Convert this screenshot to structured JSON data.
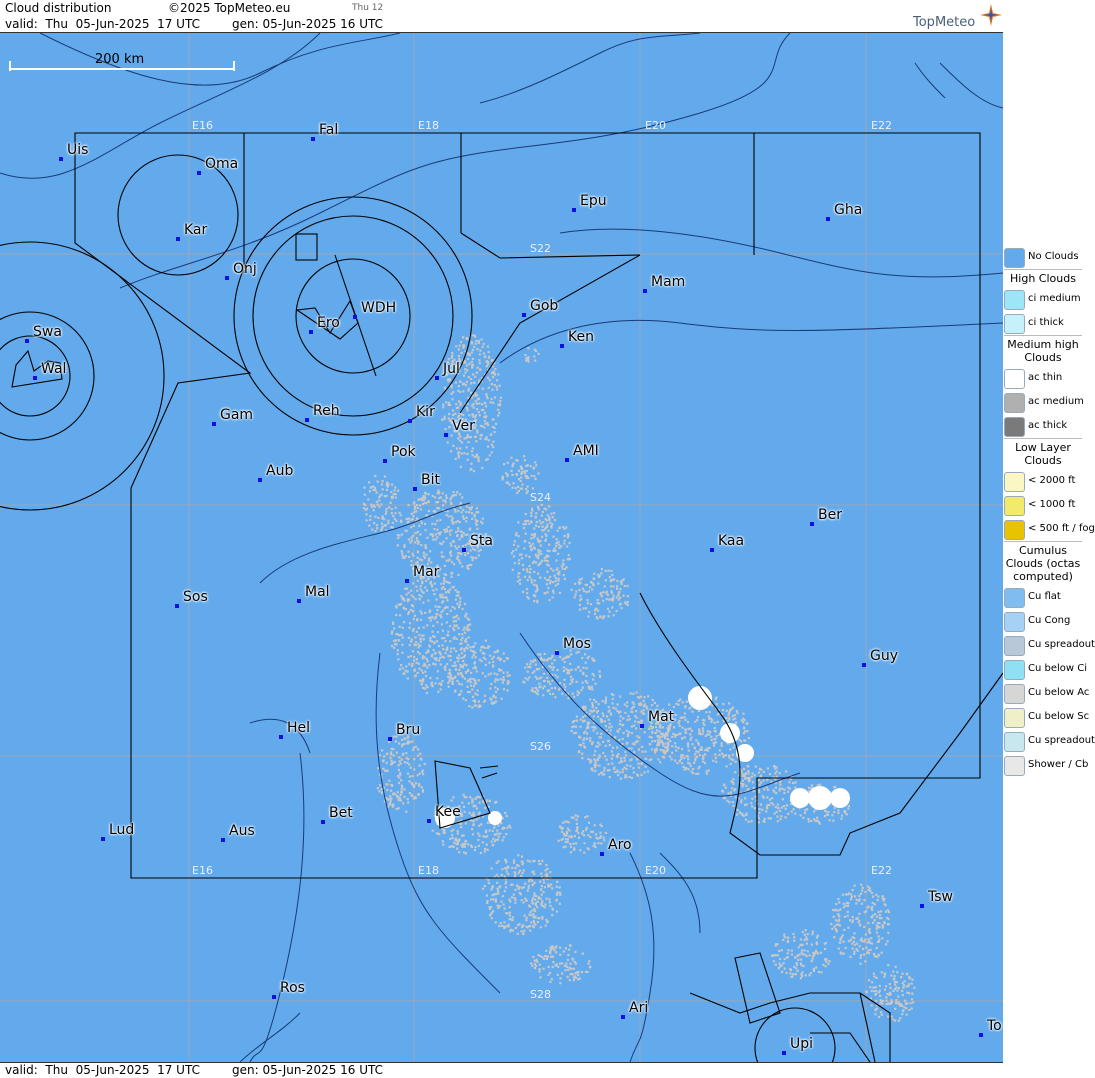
{
  "header": {
    "title": "Cloud distribution",
    "copyright": "©2025 TopMeteo.eu",
    "day_tag": "Thu 12",
    "valid": "valid:  Thu  05-Jun-2025  17 UTC",
    "gen": "gen: 05-Jun-2025 16 UTC",
    "logo_text": "TopMeteo"
  },
  "footer": {
    "valid": "valid:  Thu  05-Jun-2025  17 UTC",
    "gen": "gen: 05-Jun-2025 16 UTC"
  },
  "map": {
    "scale_label": "200 km",
    "grid_labels": [
      "E16",
      "E18",
      "E20",
      "E22",
      "S22",
      "S24",
      "S26",
      "S28",
      "E16",
      "E18",
      "E20",
      "E22"
    ],
    "cities": [
      {
        "name": "Uis"
      },
      {
        "name": "Fal"
      },
      {
        "name": "Oma"
      },
      {
        "name": "Kar"
      },
      {
        "name": "Epu"
      },
      {
        "name": "Gha"
      },
      {
        "name": "Onj"
      },
      {
        "name": "Mam"
      },
      {
        "name": "Swa"
      },
      {
        "name": "WDH"
      },
      {
        "name": "Gob"
      },
      {
        "name": "Ero"
      },
      {
        "name": "Ken"
      },
      {
        "name": "Wal"
      },
      {
        "name": "Jul"
      },
      {
        "name": "Gam"
      },
      {
        "name": "Reh"
      },
      {
        "name": "Kir"
      },
      {
        "name": "Ver"
      },
      {
        "name": "Pok"
      },
      {
        "name": "AMI"
      },
      {
        "name": "Aub"
      },
      {
        "name": "Bit"
      },
      {
        "name": "Ber"
      },
      {
        "name": "Sta"
      },
      {
        "name": "Kaa"
      },
      {
        "name": "Mar"
      },
      {
        "name": "Sos"
      },
      {
        "name": "Mal"
      },
      {
        "name": "Mos"
      },
      {
        "name": "Guy"
      },
      {
        "name": "Mat"
      },
      {
        "name": "Hel"
      },
      {
        "name": "Bru"
      },
      {
        "name": "Bet"
      },
      {
        "name": "Kee"
      },
      {
        "name": "Lud"
      },
      {
        "name": "Aus"
      },
      {
        "name": "Aro"
      },
      {
        "name": "Tsw"
      },
      {
        "name": "Ros"
      },
      {
        "name": "Ari"
      },
      {
        "name": "To"
      },
      {
        "name": "Upi"
      }
    ]
  },
  "legend": {
    "items": [
      {
        "type": "row",
        "label": "No Clouds",
        "color": "#62aaec"
      },
      {
        "type": "head",
        "label": "High Clouds"
      },
      {
        "type": "row",
        "label": "ci medium",
        "color": "#9de6f7"
      },
      {
        "type": "row",
        "label": "ci thick",
        "color": "#c4f1fa"
      },
      {
        "type": "head",
        "label": "Medium high Clouds"
      },
      {
        "type": "row",
        "label": "ac thin",
        "color": "#ffffff"
      },
      {
        "type": "row",
        "label": "ac medium",
        "color": "#b0b0b0"
      },
      {
        "type": "row",
        "label": "ac thick",
        "color": "#7a7a7a"
      },
      {
        "type": "head",
        "label": "Low Layer Clouds"
      },
      {
        "type": "row",
        "label": "< 2000 ft",
        "color": "#fbf7c5"
      },
      {
        "type": "row",
        "label": "< 1000 ft",
        "color": "#f2ea6a"
      },
      {
        "type": "row",
        "label": "< 500 ft / fog",
        "color": "#e8c400"
      },
      {
        "type": "head",
        "label": "Cumulus Clouds (octas computed)"
      },
      {
        "type": "row",
        "label": "Cu flat",
        "color": "#7fbcef"
      },
      {
        "type": "row",
        "label": "Cu Cong",
        "color": "#a6d1f5"
      },
      {
        "type": "row",
        "label": "Cu spreadout",
        "color": "#b8c8d8"
      },
      {
        "type": "row",
        "label": "Cu below Ci",
        "color": "#8fe0f2"
      },
      {
        "type": "row",
        "label": "Cu below Ac",
        "color": "#d6d6d6"
      },
      {
        "type": "row",
        "label": "Cu below Sc",
        "color": "#f0f0c8"
      },
      {
        "type": "row",
        "label": "Cu spreadout below Ci",
        "color": "#c8e8f0"
      },
      {
        "type": "row",
        "label": "Shower / Cb",
        "color": "#e8e8e8"
      }
    ]
  },
  "colors": {
    "sea": "#62aaec",
    "grid": "#9aa8b8",
    "border": "#000000",
    "dot": "#1010e0",
    "cloud": "#c8c8c8"
  }
}
